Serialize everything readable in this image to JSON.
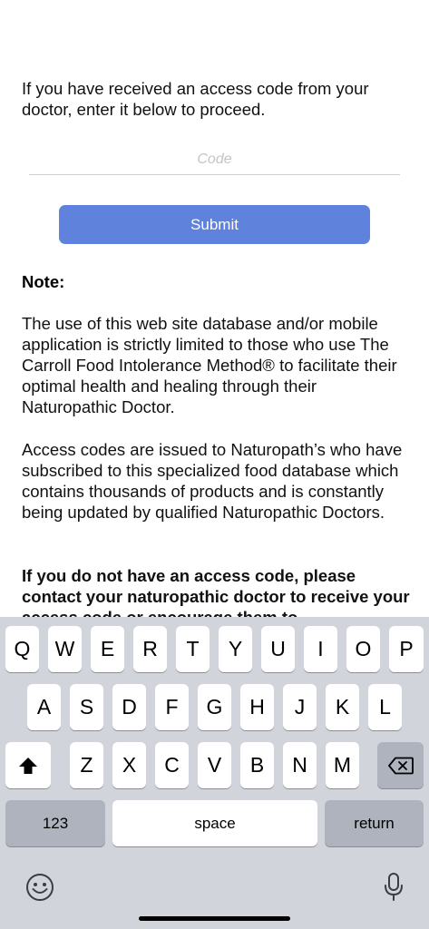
{
  "intro_text": "If you have received an access code from your doctor, enter it below to proceed.",
  "code_field": {
    "placeholder": "Code",
    "value": ""
  },
  "submit_label": "Submit",
  "note": {
    "title": "Note:",
    "paragraph1": "The use of this web site database and/or mobile application is strictly limited to those who use The Carroll Food Intolerance Method® to facilitate their optimal health and healing through their Naturopathic Doctor.",
    "paragraph2": "Access codes are issued to Naturopath’s who have subscribed to this specialized food database which contains thousands of products and is constantly being updated by qualified Naturopathic Doctors.",
    "paragraph3": "If you do not have an access code, please contact your naturopathic doctor to receive your access code or encourage them to"
  },
  "keyboard": {
    "row1": [
      "Q",
      "W",
      "E",
      "R",
      "T",
      "Y",
      "U",
      "I",
      "O",
      "P"
    ],
    "row2": [
      "A",
      "S",
      "D",
      "F",
      "G",
      "H",
      "J",
      "K",
      "L"
    ],
    "row3": [
      "Z",
      "X",
      "C",
      "V",
      "B",
      "N",
      "M"
    ],
    "numbers_label": "123",
    "space_label": "space",
    "return_label": "return",
    "icons": {
      "shift": "shift-icon",
      "delete": "backspace-icon",
      "emoji": "emoji-icon",
      "dictation": "microphone-icon"
    }
  }
}
